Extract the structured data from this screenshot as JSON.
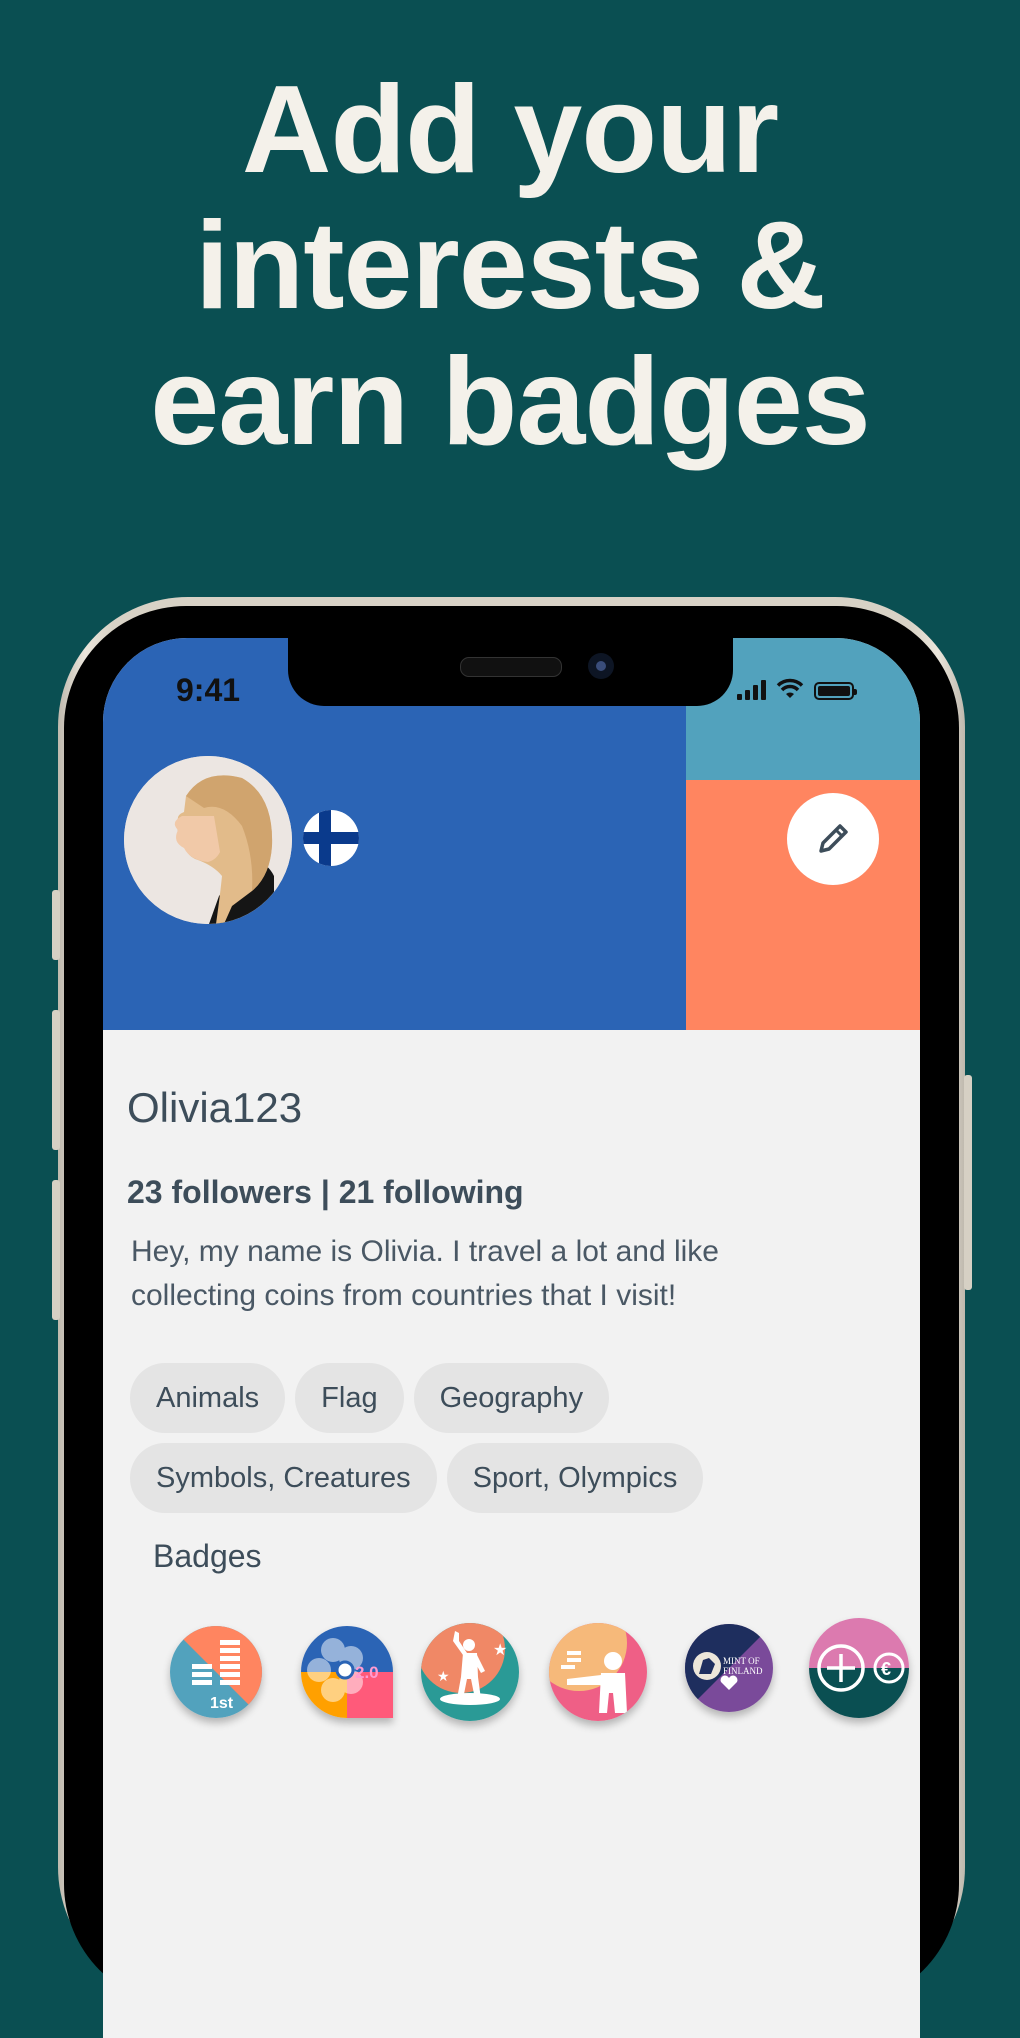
{
  "headline": {
    "lines": [
      "Add your",
      "interests &",
      "earn badges"
    ]
  },
  "status_bar": {
    "time": "9:41",
    "icons": [
      "cellular-signal-icon",
      "wifi-icon",
      "battery-icon"
    ]
  },
  "profile": {
    "username": "Olivia123",
    "followers_text": "23 followers | 21 following",
    "followers": 23,
    "following": 21,
    "bio": "Hey, my name is Olivia. I travel a lot and like collecting coins from countries that I visit!",
    "country_flag": "finland-flag-icon",
    "edit_icon": "pencil-icon"
  },
  "interests": [
    "Animals",
    "Flag",
    "Geography",
    "Symbols, Creatures",
    "Sport, Olympics"
  ],
  "badges": {
    "title": "Badges",
    "items": [
      {
        "name": "first-coins-badge",
        "label": "1st",
        "colors": [
          "#52a2bd",
          "#ff8560"
        ]
      },
      {
        "name": "version-2-badge",
        "label": "2.0",
        "colors": [
          "#2b64b5",
          "#ffa000",
          "#ff5a7a"
        ]
      },
      {
        "name": "dancer-stars-badge",
        "label": "",
        "colors": [
          "#2a9a96",
          "#f08866"
        ]
      },
      {
        "name": "coin-giver-badge",
        "label": "",
        "colors": [
          "#ef5f86",
          "#f6b97a"
        ]
      },
      {
        "name": "mint-of-finland-badge",
        "label": "MINT OF FINLAND",
        "colors": [
          "#1e2e5e",
          "#7a4a9a"
        ]
      },
      {
        "name": "add-euro-badge",
        "label": "€",
        "colors": [
          "#dc7aaf",
          "#0a4f52"
        ]
      }
    ]
  }
}
